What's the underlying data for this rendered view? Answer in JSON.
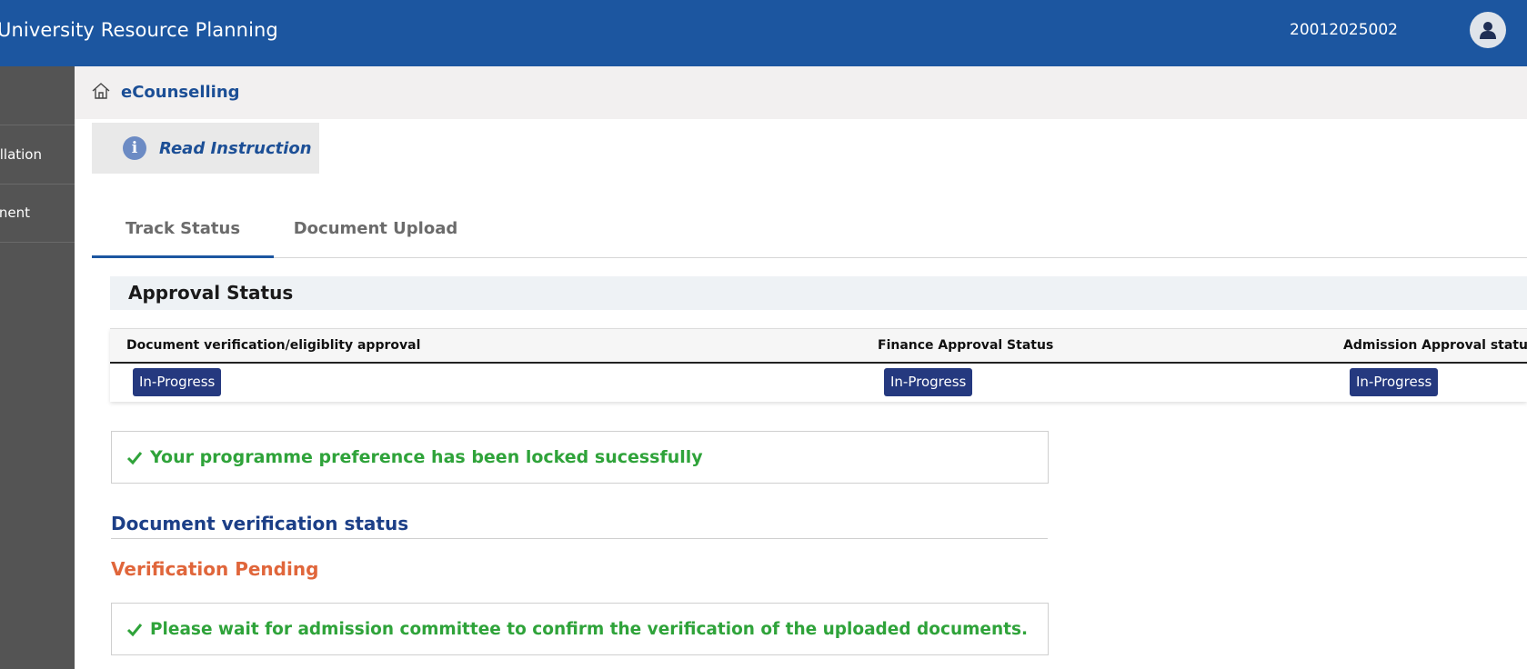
{
  "header": {
    "app_title": "University Resource Planning",
    "user_id": "20012025002"
  },
  "sidebar": {
    "items": [
      {
        "label": "llation"
      },
      {
        "label": "nent"
      }
    ]
  },
  "breadcrumb": {
    "label": "eCounselling"
  },
  "read_instruction": {
    "label": "Read Instruction",
    "icon_glyph": "i"
  },
  "tabs": [
    {
      "label": "Track Status",
      "active": true
    },
    {
      "label": "Document Upload",
      "active": false
    }
  ],
  "approval": {
    "section_title": "Approval Status",
    "columns": [
      {
        "header": "Document verification/eligiblity approval",
        "status": "In-Progress"
      },
      {
        "header": "Finance Approval Status",
        "status": "In-Progress"
      },
      {
        "header": "Admission Approval statu",
        "status": "In-Progress"
      }
    ]
  },
  "messages": {
    "locked": "Your programme preference has been locked sucessfully",
    "doc_title": "Document verification status",
    "pending": "Verification Pending",
    "wait": "Please wait for admission committee to confirm the verification of the uploaded documents."
  },
  "colors": {
    "primary": "#1c56a0",
    "sidebar": "#545454",
    "badge": "#25397f",
    "success": "#2fa33a",
    "warning": "#e0663b"
  }
}
